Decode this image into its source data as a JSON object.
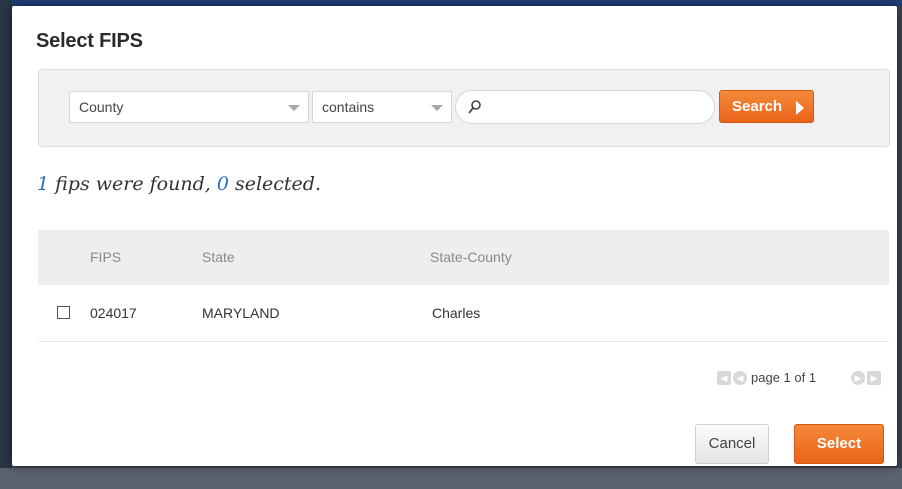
{
  "dialog": {
    "title": "Select FIPS"
  },
  "search": {
    "field_value": "County",
    "operator_value": "contains",
    "query_value": "",
    "query_placeholder": "",
    "button_label": "Search"
  },
  "summary": {
    "found_count": "1",
    "found_text": " fips were found, ",
    "selected_count": "0",
    "selected_text": " selected."
  },
  "table": {
    "columns": [
      "FIPS",
      "State",
      "State-County"
    ],
    "rows": [
      {
        "checked": false,
        "fips": "024017",
        "state": "MARYLAND",
        "county": "Charles"
      }
    ]
  },
  "pager": {
    "text": "page 1 of 1"
  },
  "footer": {
    "cancel_label": "Cancel",
    "select_label": "Select"
  },
  "colors": {
    "accent": "#ee7125",
    "link_number": "#2d6fb6"
  }
}
